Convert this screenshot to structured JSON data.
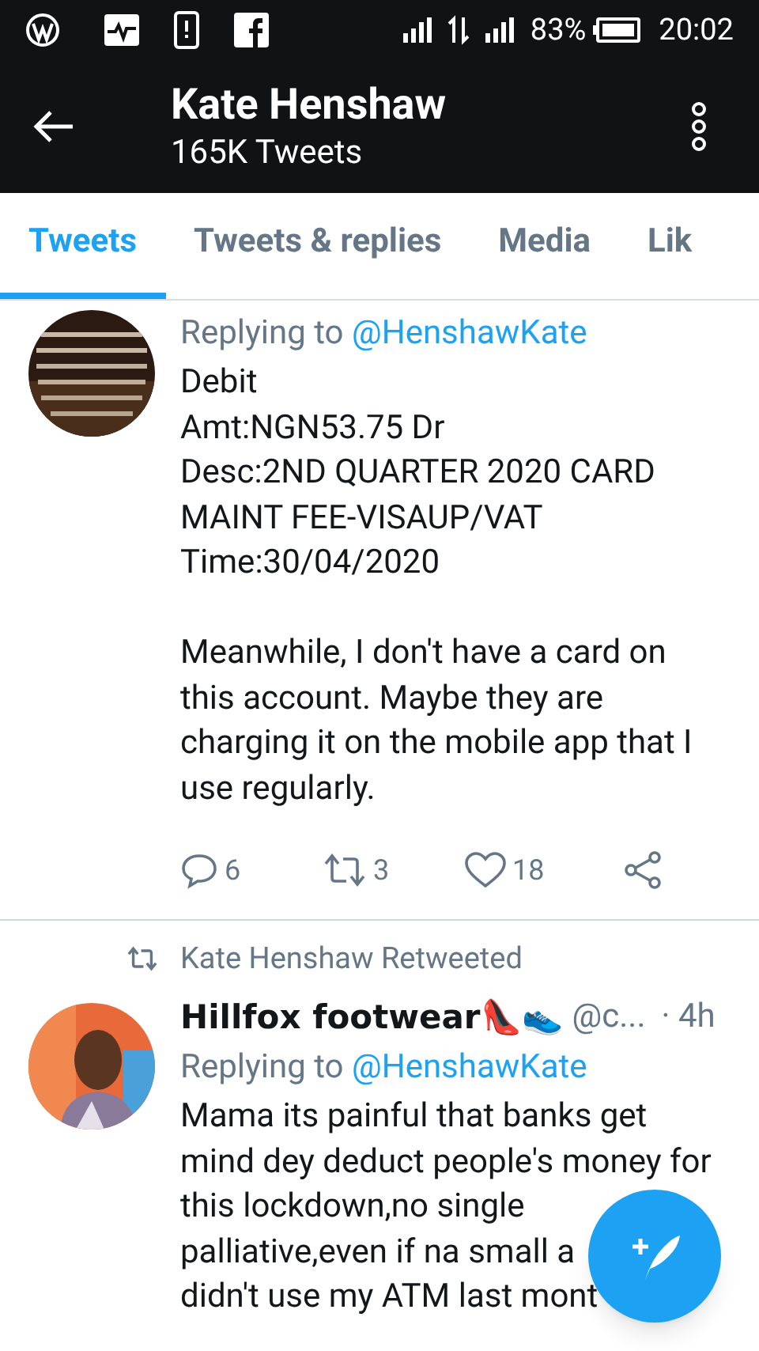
{
  "status_bar": {
    "battery": "83%",
    "time": "20:02"
  },
  "header": {
    "title": "Kate Henshaw",
    "subtitle": "165K Tweets"
  },
  "tabs": [
    {
      "label": "Tweets",
      "selected": true
    },
    {
      "label": "Tweets & replies",
      "selected": false
    },
    {
      "label": "Media",
      "selected": false
    },
    {
      "label": "Lik",
      "selected": false
    }
  ],
  "tweets": [
    {
      "avatar": {
        "kind": "picture"
      },
      "replying_prefix": "Replying to",
      "replying_to": "@HenshawKate",
      "paragraphs": [
        [
          "Debit",
          "Amt:NGN53.75 Dr",
          "Desc:2ND QUARTER 2020 CARD",
          "MAINT FEE-VISAUP/VAT",
          "Time:30/04/2020"
        ],
        [
          "Meanwhile, I don't have a card on",
          "this account. Maybe they are",
          "charging it on the mobile app that I",
          "use regularly."
        ]
      ],
      "replies": "6",
      "retweets": "3",
      "likes": "18"
    },
    {
      "avatar": {
        "kind": "picture"
      },
      "retweeted_by": "Kate Henshaw Retweeted",
      "name": "Hillfox footwear👠👟",
      "handle": "@c...",
      "time": "· 4h",
      "replying_prefix": "Replying to",
      "replying_to": "@HenshawKate",
      "paragraphs": [
        [
          "Mama its painful that banks get",
          "mind dey deduct people's money for",
          "this lockdown,no single",
          "palliative,even if na small a",
          "didn't use my ATM last mont"
        ]
      ]
    }
  ]
}
